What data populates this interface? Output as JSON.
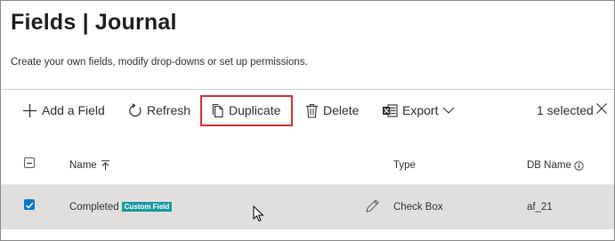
{
  "header": {
    "title": "Fields | Journal",
    "subtitle": "Create your own fields, modify drop-downs or set up permissions."
  },
  "toolbar": {
    "add_label": "Add a Field",
    "refresh_label": "Refresh",
    "duplicate_label": "Duplicate",
    "delete_label": "Delete",
    "export_label": "Export",
    "selected_text": "1 selected",
    "highlight_color": "#d13438"
  },
  "table": {
    "columns": {
      "name": "Name",
      "type": "Type",
      "db_name": "DB Name"
    },
    "rows": [
      {
        "name": "Completed",
        "badge": "Custom Field",
        "type": "Check Box",
        "db_name": "af_21",
        "selected": true
      }
    ]
  },
  "colors": {
    "accent": "#0078d4",
    "badge": "#1a9ba1",
    "selected_row": "#e1dfdd"
  }
}
